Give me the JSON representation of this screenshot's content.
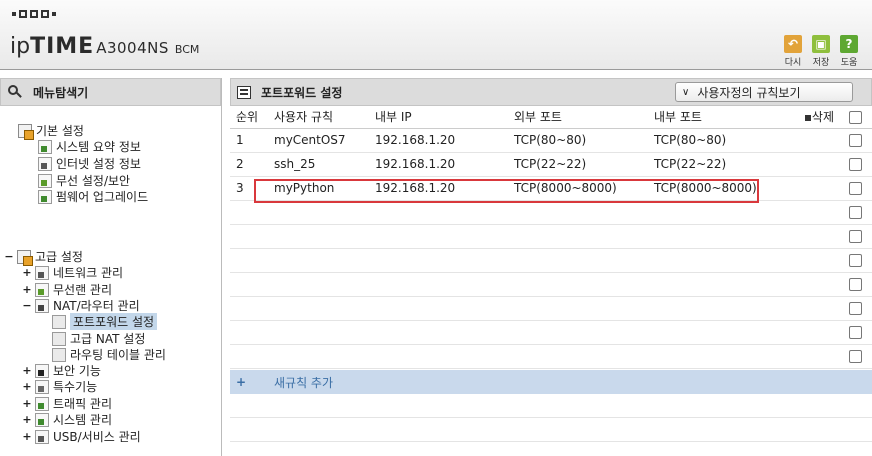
{
  "header": {
    "brand_ip": "ip",
    "brand_time": "TIME",
    "brand_model": "A3004NS",
    "brand_variant": "BCM",
    "buttons": [
      {
        "label": "다시",
        "icon": "undo-icon"
      },
      {
        "label": "저장",
        "icon": "save-icon"
      },
      {
        "label": "도움",
        "icon": "help-icon"
      }
    ]
  },
  "sidebar": {
    "title": "메뉴탐색기",
    "basic": {
      "label": "기본 설정",
      "items": [
        "시스템 요약 정보",
        "인터넷 설정 정보",
        "무선 설정/보안",
        "펌웨어 업그레이드"
      ]
    },
    "advanced": {
      "label": "고급 설정",
      "items": [
        {
          "label": "네트워크 관리",
          "toggle": "+"
        },
        {
          "label": "무선랜 관리",
          "toggle": "+"
        },
        {
          "label": "NAT/라우터 관리",
          "toggle": "−"
        },
        {
          "label": "보안 기능",
          "toggle": "+"
        },
        {
          "label": "특수기능",
          "toggle": "+"
        },
        {
          "label": "트래픽 관리",
          "toggle": "+"
        },
        {
          "label": "시스템 관리",
          "toggle": "+"
        },
        {
          "label": "USB/서비스 관리",
          "toggle": "+"
        }
      ],
      "nat_children": [
        "포트포워드 설정",
        "고급 NAT 설정",
        "라우팅 테이블 관리"
      ]
    }
  },
  "main": {
    "title": "포트포워드 설정",
    "view_dropdown": "사용자정의 규칙보기",
    "columns": [
      "순위",
      "사용자 규칙",
      "내부 IP",
      "외부 포트",
      "내부 포트",
      "삭제"
    ],
    "rows": [
      {
        "rank": "1",
        "name": "myCentOS7",
        "ip": "192.168.1.20",
        "ext": "TCP(80~80)",
        "int": "TCP(80~80)"
      },
      {
        "rank": "2",
        "name": "ssh_25",
        "ip": "192.168.1.20",
        "ext": "TCP(22~22)",
        "int": "TCP(22~22)"
      },
      {
        "rank": "3",
        "name": "myPython",
        "ip": "192.168.1.20",
        "ext": "TCP(8000~8000)",
        "int": "TCP(8000~8000)"
      }
    ],
    "add_symbol": "+",
    "add_label": "새규칙 추가",
    "highlight_color": "#d9383c"
  }
}
